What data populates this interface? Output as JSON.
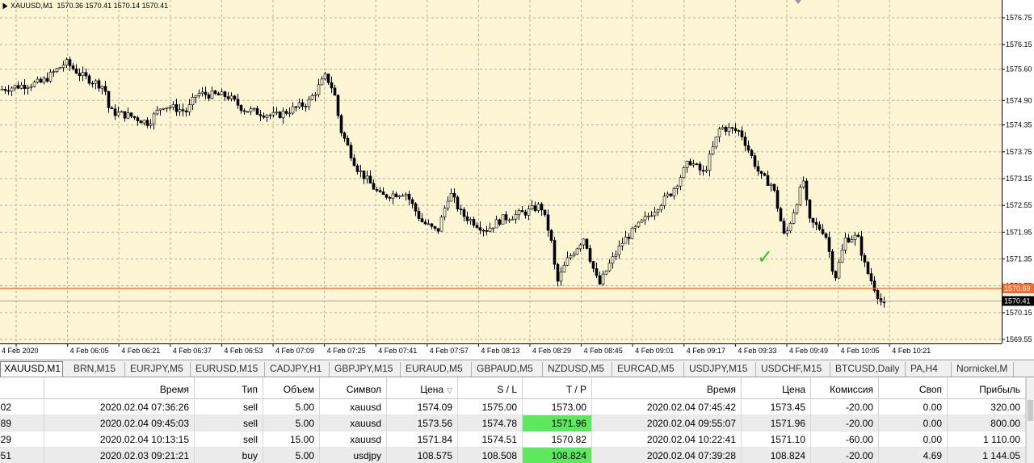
{
  "chart": {
    "symbol_label": "XAUUSD,M1",
    "ohlc_label": "1570.36 1570.41 1570.14 1570.41",
    "price_labels": [
      "1576.75",
      "1576.15",
      "1575.60",
      "1574.90",
      "1574.35",
      "1573.75",
      "1573.15",
      "1572.55",
      "1571.95",
      "1571.35",
      "1570.75",
      "1570.15",
      "1569.55"
    ],
    "time_labels": [
      "4 Feb 2020",
      "4 Feb 06:05",
      "4 Feb 06:21",
      "4 Feb 06:37",
      "4 Feb 06:53",
      "4 Feb 07:09",
      "4 Feb 07:25",
      "4 Feb 07:41",
      "4 Feb 07:57",
      "4 Feb 08:13",
      "4 Feb 08:29",
      "4 Feb 08:45",
      "4 Feb 09:01",
      "4 Feb 09:17",
      "4 Feb 09:33",
      "4 Feb 09:49",
      "4 Feb 10:05",
      "4 Feb 10:21"
    ],
    "tp_line_price": "1570.69",
    "current_price": "1570.41",
    "colors": {
      "background": "#fdf5d4",
      "grid": "#b8b09a",
      "candle": "#000000",
      "tp_line": "#ff6a2a",
      "bid_line": "#a0a0a0",
      "check": "#22cc22"
    },
    "check_icon": "✓"
  },
  "tabs": [
    {
      "label": "XAUUSD,M1",
      "active": true
    },
    {
      "label": "BRN,M15"
    },
    {
      "label": "EURJPY,M5"
    },
    {
      "label": "EURUSD,M15"
    },
    {
      "label": "CADJPY,H1"
    },
    {
      "label": "GBPJPY,M15"
    },
    {
      "label": "EURAUD,M5"
    },
    {
      "label": "GBPAUD,M5"
    },
    {
      "label": "NZDUSD,M5"
    },
    {
      "label": "EURCAD,M5"
    },
    {
      "label": "USDJPY,M15"
    },
    {
      "label": "USDCHF,M15"
    },
    {
      "label": "BTCUSD,Daily"
    },
    {
      "label": "PA,H4"
    },
    {
      "label": "Nornickel,M"
    }
  ],
  "trades": {
    "columns": [
      "",
      "Время",
      "Тип",
      "Объем",
      "Символ",
      "Цена",
      "S / L",
      "T / P",
      "Время",
      "Цена",
      "Комиссия",
      "Своп",
      "Прибыль"
    ],
    "rows": [
      {
        "id": "702",
        "open_time": "2020.02.04 07:36:26",
        "type": "sell",
        "volume": "5.00",
        "symbol": "xauusd",
        "price": "1574.09",
        "sl": "1575.00",
        "tp": "1573.00",
        "close_time": "2020.02.04 07:45:42",
        "close_price": "1573.45",
        "commission": "-20.00",
        "swap": "0.00",
        "profit": "320.00",
        "tp_hit": false
      },
      {
        "id": "789",
        "open_time": "2020.02.04 09:45:03",
        "type": "sell",
        "volume": "5.00",
        "symbol": "xauusd",
        "price": "1573.56",
        "sl": "1574.78",
        "tp": "1571.96",
        "close_time": "2020.02.04 09:55:07",
        "close_price": "1571.96",
        "commission": "-20.00",
        "swap": "0.00",
        "profit": "800.00",
        "tp_hit": true
      },
      {
        "id": "429",
        "open_time": "2020.02.04 10:13:15",
        "type": "sell",
        "volume": "15.00",
        "symbol": "xauusd",
        "price": "1571.84",
        "sl": "1574.51",
        "tp": "1570.82",
        "close_time": "2020.02.04 10:22:41",
        "close_price": "1571.10",
        "commission": "-60.00",
        "swap": "0.00",
        "profit": "1 110.00",
        "tp_hit": false
      },
      {
        "id": "051",
        "open_time": "2020.02.03 09:21:21",
        "type": "buy",
        "volume": "5.00",
        "symbol": "usdjpy",
        "price": "108.575",
        "sl": "108.508",
        "tp": "108.824",
        "close_time": "2020.02.04 07:39:28",
        "close_price": "108.824",
        "commission": "-20.00",
        "swap": "4.69",
        "profit": "1 144.05",
        "tp_hit": true
      }
    ]
  }
}
